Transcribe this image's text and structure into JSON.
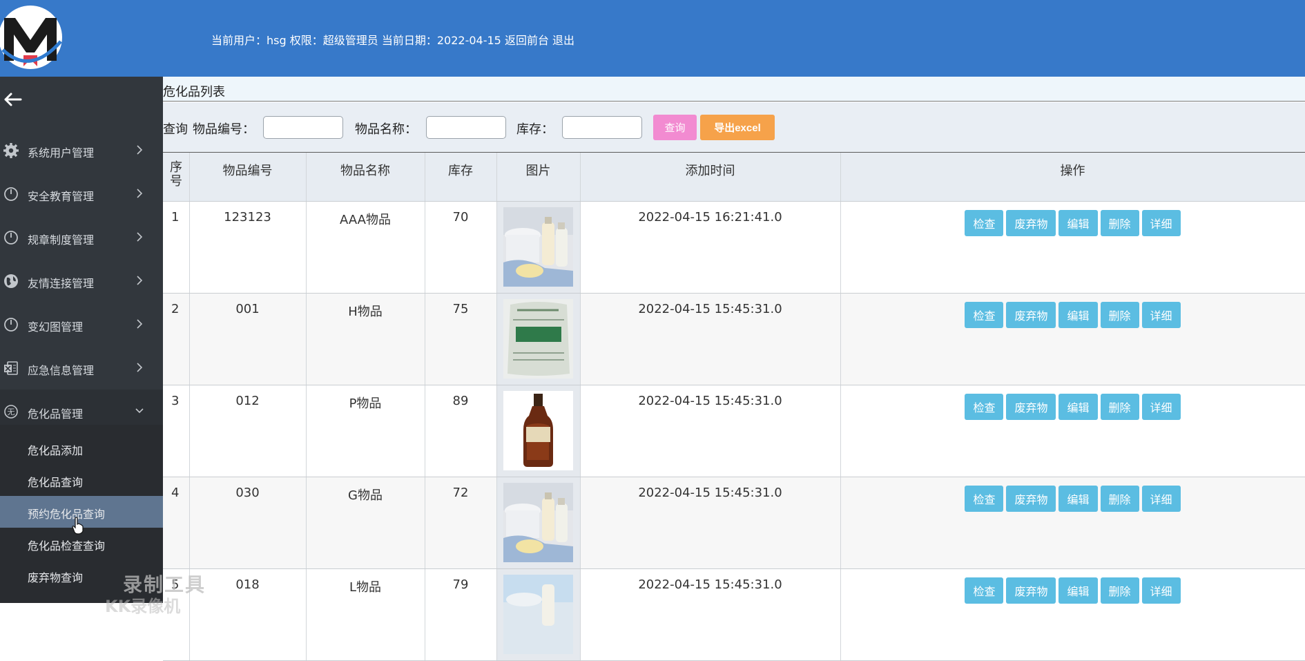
{
  "header": {
    "current_user_label": "当前用户：hsg",
    "role_label": "权限：超级管理员",
    "date_label": "当前日期：2022-04-15",
    "back_label": "返回前台",
    "logout_label": "退出"
  },
  "sidebar": {
    "items": [
      {
        "label": "系统用户管理",
        "icon": "gear-icon"
      },
      {
        "label": "安全教育管理",
        "icon": "power-icon"
      },
      {
        "label": "规章制度管理",
        "icon": "power-icon"
      },
      {
        "label": "友情连接管理",
        "icon": "globe-icon"
      },
      {
        "label": "变幻图管理",
        "icon": "power-icon"
      },
      {
        "label": "应急信息管理",
        "icon": "excel-icon"
      },
      {
        "label": "危化品管理",
        "icon": "circle-char-icon",
        "icon_char": "无"
      }
    ],
    "submenu": [
      {
        "label": "危化品添加"
      },
      {
        "label": "危化品查询"
      },
      {
        "label": "预约危化品查询"
      },
      {
        "label": "危化品检查查询"
      },
      {
        "label": "废弃物查询"
      }
    ]
  },
  "watermark": {
    "line1": "录制工具",
    "line2": "KK录像机"
  },
  "main": {
    "breadcrumb": "危化品列表",
    "search": {
      "prefix": "查询",
      "code_label": "物品编号：",
      "name_label": "物品名称：",
      "stock_label": "库存：",
      "query_button": "查询",
      "export_button": "导出excel"
    },
    "table": {
      "headers": [
        "序号",
        "物品编号",
        "物品名称",
        "库存",
        "图片",
        "添加时间",
        "操作"
      ],
      "actions": [
        "检查",
        "废弃物",
        "编辑",
        "删除",
        "详细"
      ],
      "rows": [
        {
          "idx": "1",
          "code": "123123",
          "name": "AAA物品",
          "stock": "70",
          "image": "toiletries-image",
          "time": "2022-04-15 16:21:41.0"
        },
        {
          "idx": "2",
          "code": "001",
          "name": "H物品",
          "stock": "75",
          "image": "sack-image",
          "time": "2022-04-15 15:45:31.0"
        },
        {
          "idx": "3",
          "code": "012",
          "name": "P物品",
          "stock": "89",
          "image": "bottle-image",
          "time": "2022-04-15 15:45:31.0"
        },
        {
          "idx": "4",
          "code": "030",
          "name": "G物品",
          "stock": "72",
          "image": "toiletries-image",
          "time": "2022-04-15 15:45:31.0"
        },
        {
          "idx": "5",
          "code": "018",
          "name": "L物品",
          "stock": "79",
          "image": "blue-image",
          "time": "2022-04-15 15:45:31.0"
        }
      ]
    }
  }
}
